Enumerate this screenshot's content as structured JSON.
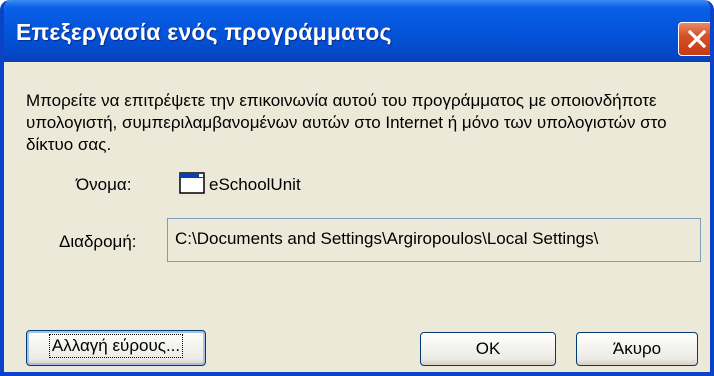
{
  "dialog": {
    "title": "Επεξεργασία ενός προγράμματος",
    "description": "Μπορείτε να επιτρέψετε την επικοινωνία αυτού του προγράμματος με οποιονδήποτε υπολογιστή, συμπεριλαμβανομένων αυτών στο Internet ή μόνο των υπολογιστών στο δίκτυο σας.",
    "name_label": "Όνομα:",
    "program_name": "eSchoolUnit",
    "path_label": "Διαδρομή:",
    "path_value": "C:\\Documents and Settings\\Argiropoulos\\Local Settings\\",
    "buttons": {
      "change_scope": "Αλλαγή εύρους...",
      "ok": "OK",
      "cancel": "Άκυρο"
    },
    "icons": {
      "close": "close-icon",
      "program": "application-window-icon"
    },
    "colors": {
      "titlebar": "#0453D9",
      "close_button": "#D8502A",
      "dialog_background": "#ECE9D8"
    }
  }
}
